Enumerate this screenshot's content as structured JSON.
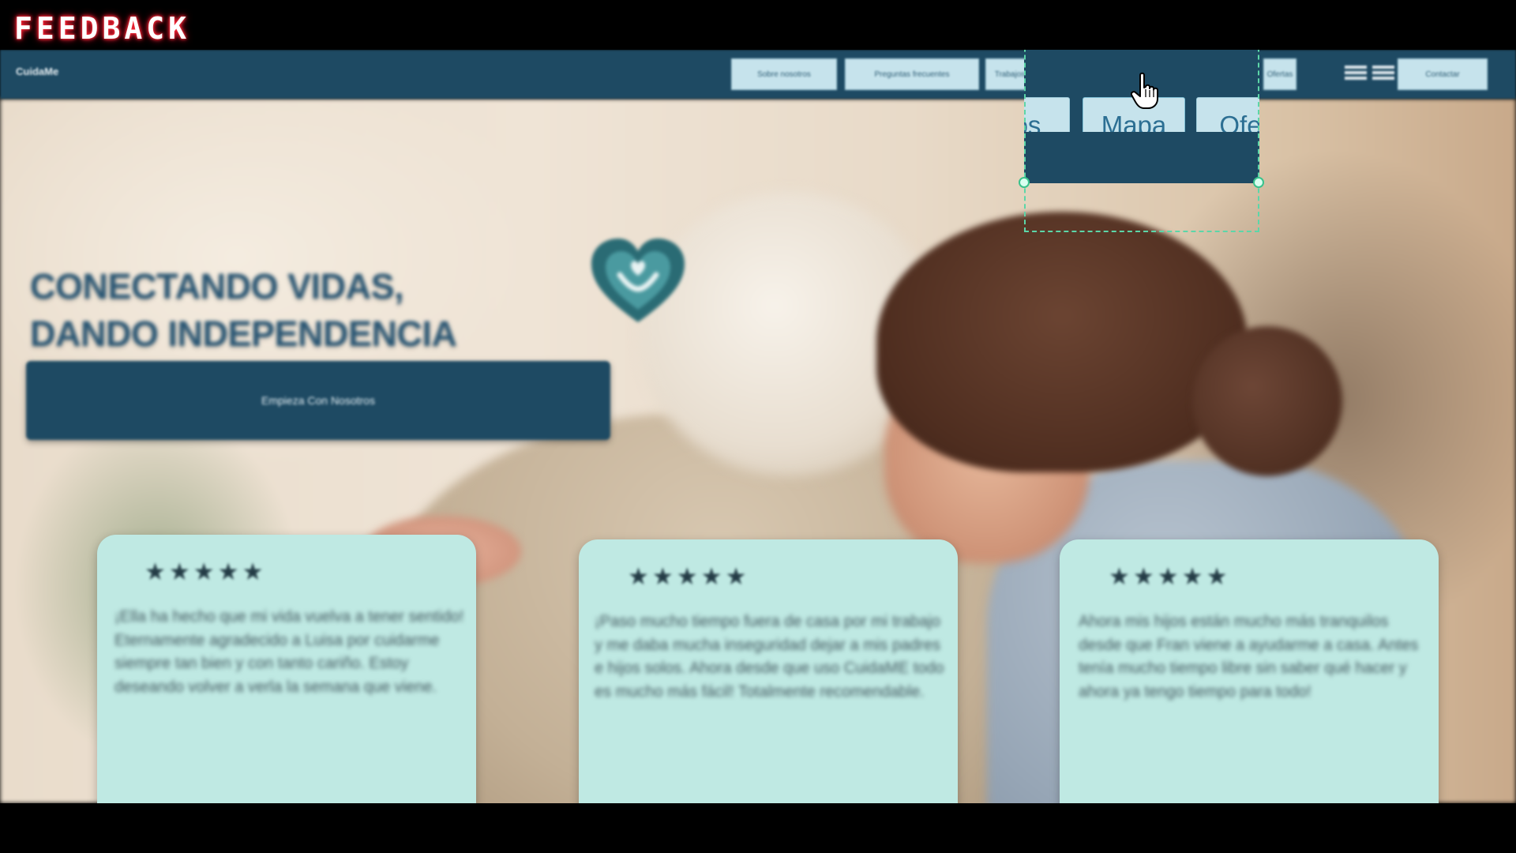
{
  "overlay": {
    "badge": "FEEDBACK"
  },
  "header": {
    "brand": "CuidaMe",
    "nav": [
      {
        "id": "nosotros",
        "label": "Sobre nosotros"
      },
      {
        "id": "preguntas",
        "label": "Preguntas frecuentes"
      },
      {
        "id": "trabajos",
        "label": "Trabajos"
      },
      {
        "id": "mapa",
        "label": "Mapa"
      },
      {
        "id": "ofertas",
        "label": "Ofertas"
      },
      {
        "id": "contacto",
        "label": "Contactar"
      }
    ],
    "zoom_labels": {
      "left": "os",
      "center": "Mapa",
      "right": "Ofe"
    }
  },
  "hero": {
    "title_line1": "CONECTANDO VIDAS,",
    "title_line2": "DANDO INDEPENDENCIA",
    "cta_label": "Empieza Con Nosotros",
    "logo_icon": "heart-hands-icon"
  },
  "testimonials": [
    {
      "stars": "★★★★★",
      "rating": 5,
      "text": "¡Ella ha hecho que mi vida vuelva a tener sentido! Eternamente agradecido a Luisa por cuidarme siempre tan bien y con tanto cariño. Estoy deseando volver a verla la semana que viene."
    },
    {
      "stars": "★★★★★",
      "rating": 5,
      "text": "¡Paso mucho tiempo fuera de casa por mi trabajo y me daba mucha inseguridad dejar a mis padres e hijos solos. Ahora desde que uso CuidaME todo es mucho más fácil! Totalmente recomendable."
    },
    {
      "stars": "★★★★★",
      "rating": 5,
      "text": "Ahora mis hijos están mucho más tranquilos desde que Fran viene a ayudarme a casa. Antes tenía mucho tiempo libre sin saber qué hacer y ahora ya tengo tiempo para todo!"
    }
  ],
  "colors": {
    "navbar": "#1e4a63",
    "nav_button": "#c6e3ec",
    "card": "#bfe9e3",
    "title": "#2b5774",
    "selection": "#5cd6a8"
  }
}
